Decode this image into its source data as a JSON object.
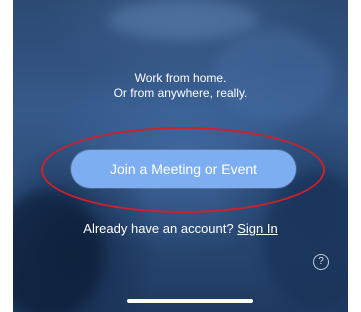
{
  "welcome": {
    "tagline_line1": "Work from home.",
    "tagline_line2": "Or from anywhere, really."
  },
  "actions": {
    "join_label": "Join a Meeting or Event",
    "account_prompt": "Already have an account?",
    "sign_in_label": "Sign In",
    "help_glyph": "?"
  },
  "colors": {
    "button_fill": "#7eaef2",
    "highlight_ring": "#d0202a",
    "background": "#35598a"
  },
  "icons": [
    "help-icon",
    "home-indicator"
  ]
}
